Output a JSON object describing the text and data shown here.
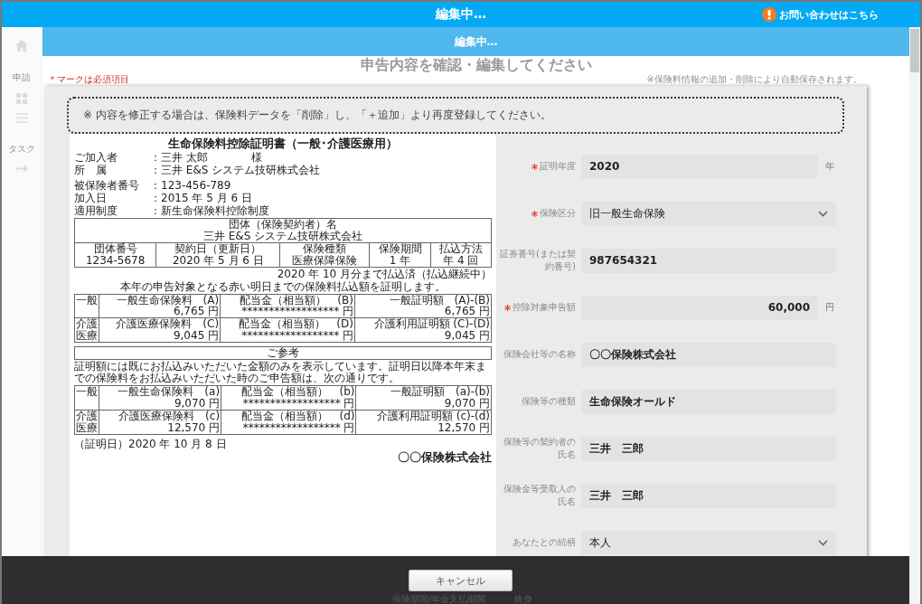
{
  "header": {
    "title": "編集中…",
    "contact_link": "お問い合わせはこちら"
  },
  "sidebar": {
    "items": [
      {
        "kind": "home"
      },
      {
        "kind": "label",
        "label": "申請"
      },
      {
        "kind": "grid"
      },
      {
        "kind": "list"
      },
      {
        "kind": "label",
        "label": "タスク"
      },
      {
        "kind": "arrow"
      }
    ]
  },
  "banner": {
    "title": "編集中…"
  },
  "page": {
    "title": "申告内容を確認・編集してください",
    "required_note": "＊マークは必須項目",
    "autosave_note": "※保険料情報の追加・削除により自動保存されます。"
  },
  "modal": {
    "notice": "※ 内容を修正する場合は、保険料データを「削除」し、「＋追加」より再度登録してください。",
    "document": {
      "title": "生命保険料控除証明書（一般･介護医療用）",
      "info": [
        {
          "label": "ご加入者",
          "value": "：三井 太郎　　　　様"
        },
        {
          "label": "所　属",
          "value": "：三井 E&S システム技研株式会社"
        }
      ],
      "info2": [
        {
          "label": "被保険者番号",
          "value": "：123-456-789"
        },
        {
          "label": "加入日",
          "value": "：2015 年 5 月 6 日"
        },
        {
          "label": "適用制度",
          "value": "：新生命保険料控除制度"
        }
      ],
      "group_table": {
        "group_label": "団体（保険契約者）名",
        "group_name": "三井 E&S システム技研株式会社",
        "columns": [
          "団体番号",
          "契約日（更新日）",
          "保険種類",
          "保険期間",
          "払込方法"
        ],
        "values": [
          "1234-5678",
          "2020 年 5 月 6 日",
          "医療保障保険",
          "1 年",
          "年 4 回"
        ]
      },
      "paid_note": "2020 年 10 月分まで払込済（払込継続中）",
      "certify_note": "本年の申告対象となる赤い明日までの保険料払込額を証明します。",
      "amounts": [
        {
          "type": "一般",
          "cells": [
            {
              "label": "一般生命保険料　(A)",
              "amount": "6,765 円"
            },
            {
              "label": "配当金（相当額）　(B)",
              "amount": "****************** 円"
            },
            {
              "label": "一般証明額　(A)-(B)",
              "amount": "6,765 円"
            }
          ]
        },
        {
          "type": "介護医療",
          "cells": [
            {
              "label": "介護医療保険料　(C)",
              "amount": "9,045 円"
            },
            {
              "label": "配当金（相当額）　(D)",
              "amount": "****************** 円"
            },
            {
              "label": "介護利用証明額 (C)-(D)",
              "amount": "9,045 円"
            }
          ]
        }
      ],
      "reference_title": "ご参考",
      "reference_note": "証明額には既にお払込みいただいた金額のみを表示しています。証明日以降本年末までの保険料をお払込みいただいた時のご申告額は、次の通りです。",
      "reference_amounts": [
        {
          "type": "一般",
          "cells": [
            {
              "label": "一般生命保険料　(a)",
              "amount": "9,070 円"
            },
            {
              "label": "配当金（相当額）　(b)",
              "amount": "****************** 円"
            },
            {
              "label": "一般証明額　(a)-(b)",
              "amount": "9,070 円"
            }
          ]
        },
        {
          "type": "介護医療",
          "cells": [
            {
              "label": "介護医療保険料　(c)",
              "amount": "12,570 円"
            },
            {
              "label": "配当金（相当額）　(d)",
              "amount": "****************** 円"
            },
            {
              "label": "介護利用証明額 (c)-(d)",
              "amount": "12,570 円"
            }
          ]
        }
      ],
      "issue_date": "（証明日）2020 年 10 月 8 日",
      "issuer": "〇〇保険株式会社"
    },
    "form": {
      "fields": [
        {
          "label": "証明年度",
          "required": true,
          "kind": "text",
          "value": "2020",
          "unit": "年"
        },
        {
          "label": "保険区分",
          "required": true,
          "kind": "select",
          "value": "旧一般生命保険"
        },
        {
          "label": "証券番号(または契約番号)",
          "required": false,
          "kind": "text",
          "value": "987654321"
        },
        {
          "label": "控除対象申告額",
          "required": true,
          "kind": "amount",
          "value": "60,000",
          "unit": "円"
        },
        {
          "label": "保険会社等の名称",
          "required": false,
          "kind": "text",
          "value": "〇〇保険株式会社"
        },
        {
          "label": "保険等の種類",
          "required": false,
          "kind": "text",
          "value": "生命保険オールド"
        },
        {
          "label": "保険等の契約者の氏名",
          "required": false,
          "kind": "text",
          "value": "三井　三郎"
        },
        {
          "label": "保険金等受取人の氏名",
          "required": false,
          "kind": "text",
          "value": "三井　三郎"
        },
        {
          "label": "あなたとの続柄",
          "required": false,
          "kind": "select",
          "value": "本人"
        }
      ]
    }
  },
  "footer": {
    "cancel_button": "キャンセル",
    "behind_row": {
      "label": "保険期間/年金支払期間",
      "value": "終身"
    }
  }
}
